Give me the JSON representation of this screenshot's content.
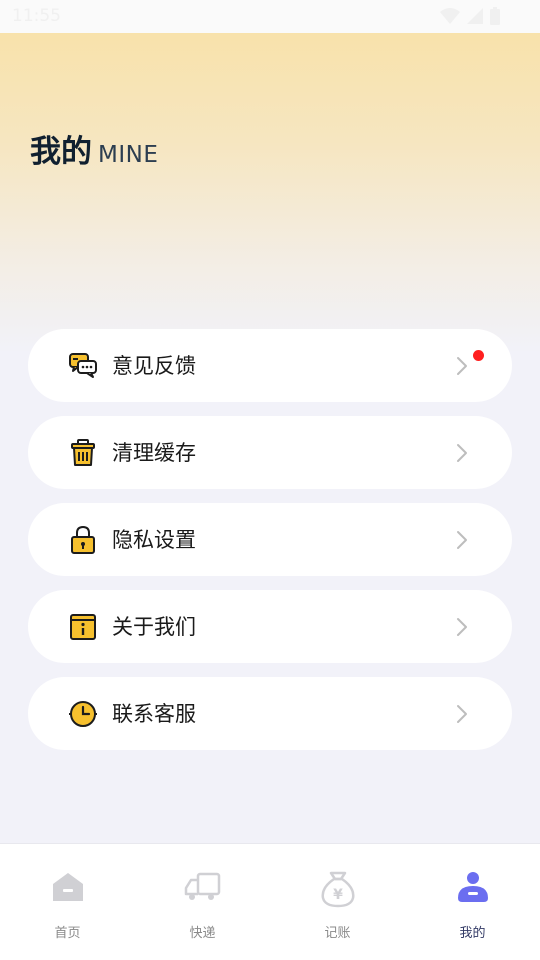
{
  "status_bar": {
    "time": "11:55"
  },
  "header": {
    "title_cn": "我的",
    "title_en": "MINE"
  },
  "menu": {
    "items": [
      {
        "label": "意见反馈",
        "icon": "chat-bubbles-icon",
        "badge": true
      },
      {
        "label": "清理缓存",
        "icon": "trash-bin-icon",
        "badge": false
      },
      {
        "label": "隐私设置",
        "icon": "padlock-icon",
        "badge": false
      },
      {
        "label": "关于我们",
        "icon": "info-card-icon",
        "badge": false
      },
      {
        "label": "联系客服",
        "icon": "clock-headset-icon",
        "badge": false
      }
    ]
  },
  "tabs": [
    {
      "label": "首页",
      "icon": "home-icon",
      "active": false
    },
    {
      "label": "快递",
      "icon": "delivery-truck-icon",
      "active": false
    },
    {
      "label": "记账",
      "icon": "money-bag-icon",
      "active": false
    },
    {
      "label": "我的",
      "icon": "profile-icon",
      "active": true
    }
  ],
  "colors": {
    "accent_yellow": "#f6c02e",
    "icon_dark": "#1c1c1c",
    "badge_red": "#ff1f1f",
    "tab_active": "#6b6ef0",
    "tab_inactive": "#d0d0d4"
  }
}
